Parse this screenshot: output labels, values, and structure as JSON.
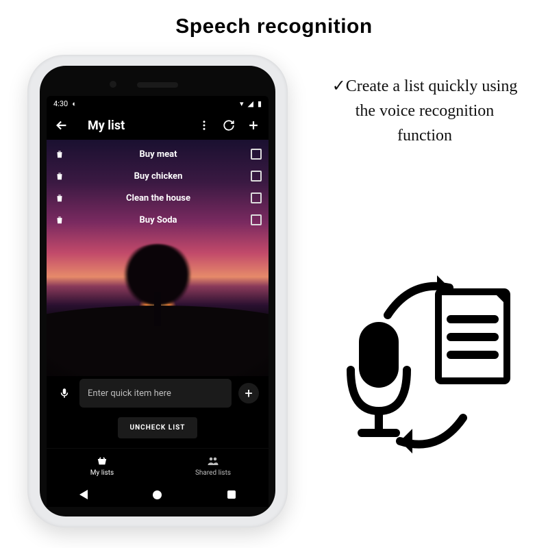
{
  "page": {
    "title": "Speech recognition"
  },
  "caption": {
    "prefix": "✓",
    "text": "Create a list quickly using the voice recognition function"
  },
  "phone": {
    "status": {
      "time": "4:30"
    },
    "topbar": {
      "title": "My list"
    },
    "list": {
      "items": [
        {
          "label": "Buy meat"
        },
        {
          "label": "Buy chicken"
        },
        {
          "label": "Clean the house"
        },
        {
          "label": "Buy Soda"
        }
      ]
    },
    "quick": {
      "placeholder": "Enter quick item here"
    },
    "buttons": {
      "uncheck": "UNCHECK LIST"
    },
    "tabs": {
      "my_lists": "My lists",
      "shared_lists": "Shared lists"
    }
  }
}
